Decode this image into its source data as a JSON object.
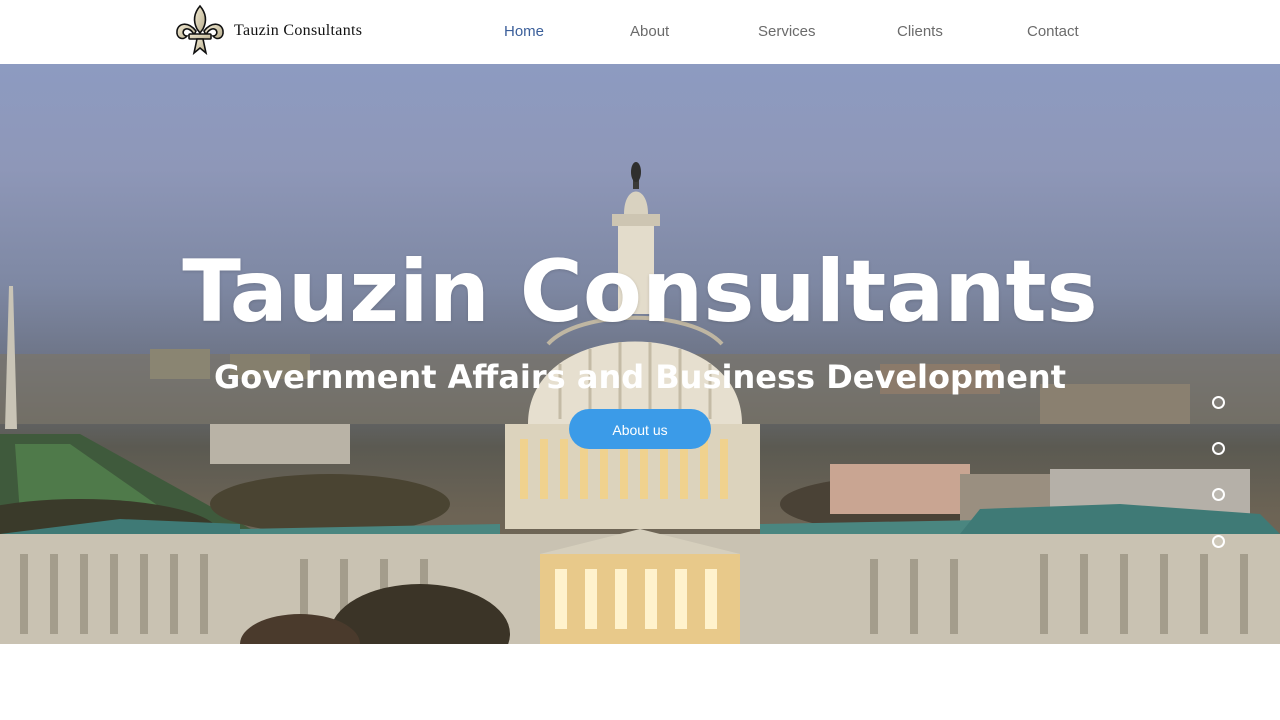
{
  "brand": {
    "name": "Tauzin Consultants",
    "logo_icon": "fleur-de-lis-icon"
  },
  "nav": {
    "items": [
      {
        "label": "Home",
        "active": true
      },
      {
        "label": "About",
        "active": false
      },
      {
        "label": "Services",
        "active": false
      },
      {
        "label": "Clients",
        "active": false
      },
      {
        "label": "Contact",
        "active": false
      }
    ]
  },
  "hero": {
    "title": "Tauzin Consultants",
    "subtitle": "Government Affairs and Business Development",
    "cta_label": "About us",
    "cta_color": "#3b9be8",
    "slide_dots_count": 4
  },
  "colors": {
    "nav_active": "#3b5f9a",
    "nav_text": "#6b6b6b"
  }
}
